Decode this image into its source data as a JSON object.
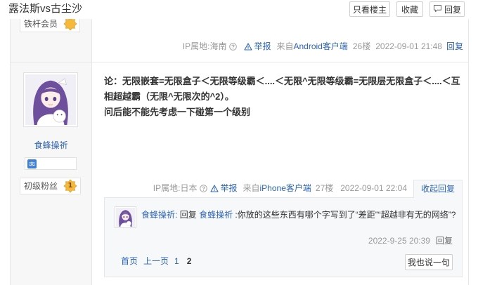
{
  "page": {
    "title": "露法斯vs古尘沙"
  },
  "toolbar": {
    "only_op_label": "只看楼主",
    "favorite_label": "收藏",
    "reply_label": "回复"
  },
  "post26": {
    "member_badge": "铁杆会员",
    "ip": "IP属地:海南",
    "report_label": "举报",
    "source_prefix": "来自",
    "source": "Android客户端",
    "floor": "26楼",
    "time": "2022-09-01 21:48",
    "reply_label": "回复"
  },
  "post27": {
    "username": "食蜂操祈",
    "level_title": "初级粉丝",
    "level_num": "1",
    "content": [
      "论：无限嵌套=无限盒子＜无限等级霸＜....＜无限^无限等级霸=无限层无限盒子＜....＜互相超越霸（无限^无限次的^2）。",
      "问后能不能先考虑一下碰第一个级别"
    ],
    "ip": "IP属地:日本",
    "report_label": "举报",
    "source_prefix": "来自",
    "source": "iPhone客户端",
    "floor": "27楼",
    "time": "2022-09-01 22:04",
    "collapse_label": "收起回复",
    "sub_replies": [
      {
        "username": "食蜂操祈",
        "name_sep": ":",
        "reply_word": "回复",
        "reply_to": "食蜂操祈",
        "text": ":你放的这些东西有哪个字写到了“差距”“超越非有无的网络”?",
        "time": "2022-9-25 20:39",
        "reply_label": "回复"
      }
    ],
    "pagination": {
      "first": "首页",
      "prev": "上一页",
      "pages": [
        "1",
        "2"
      ]
    },
    "comment_button": "我也说一句"
  },
  "colors": {
    "link": "#2d64b3",
    "meta": "#999999",
    "text": "#333333",
    "badge_gold": "#f6b93b",
    "sub_bg": "#f7f8fa"
  }
}
